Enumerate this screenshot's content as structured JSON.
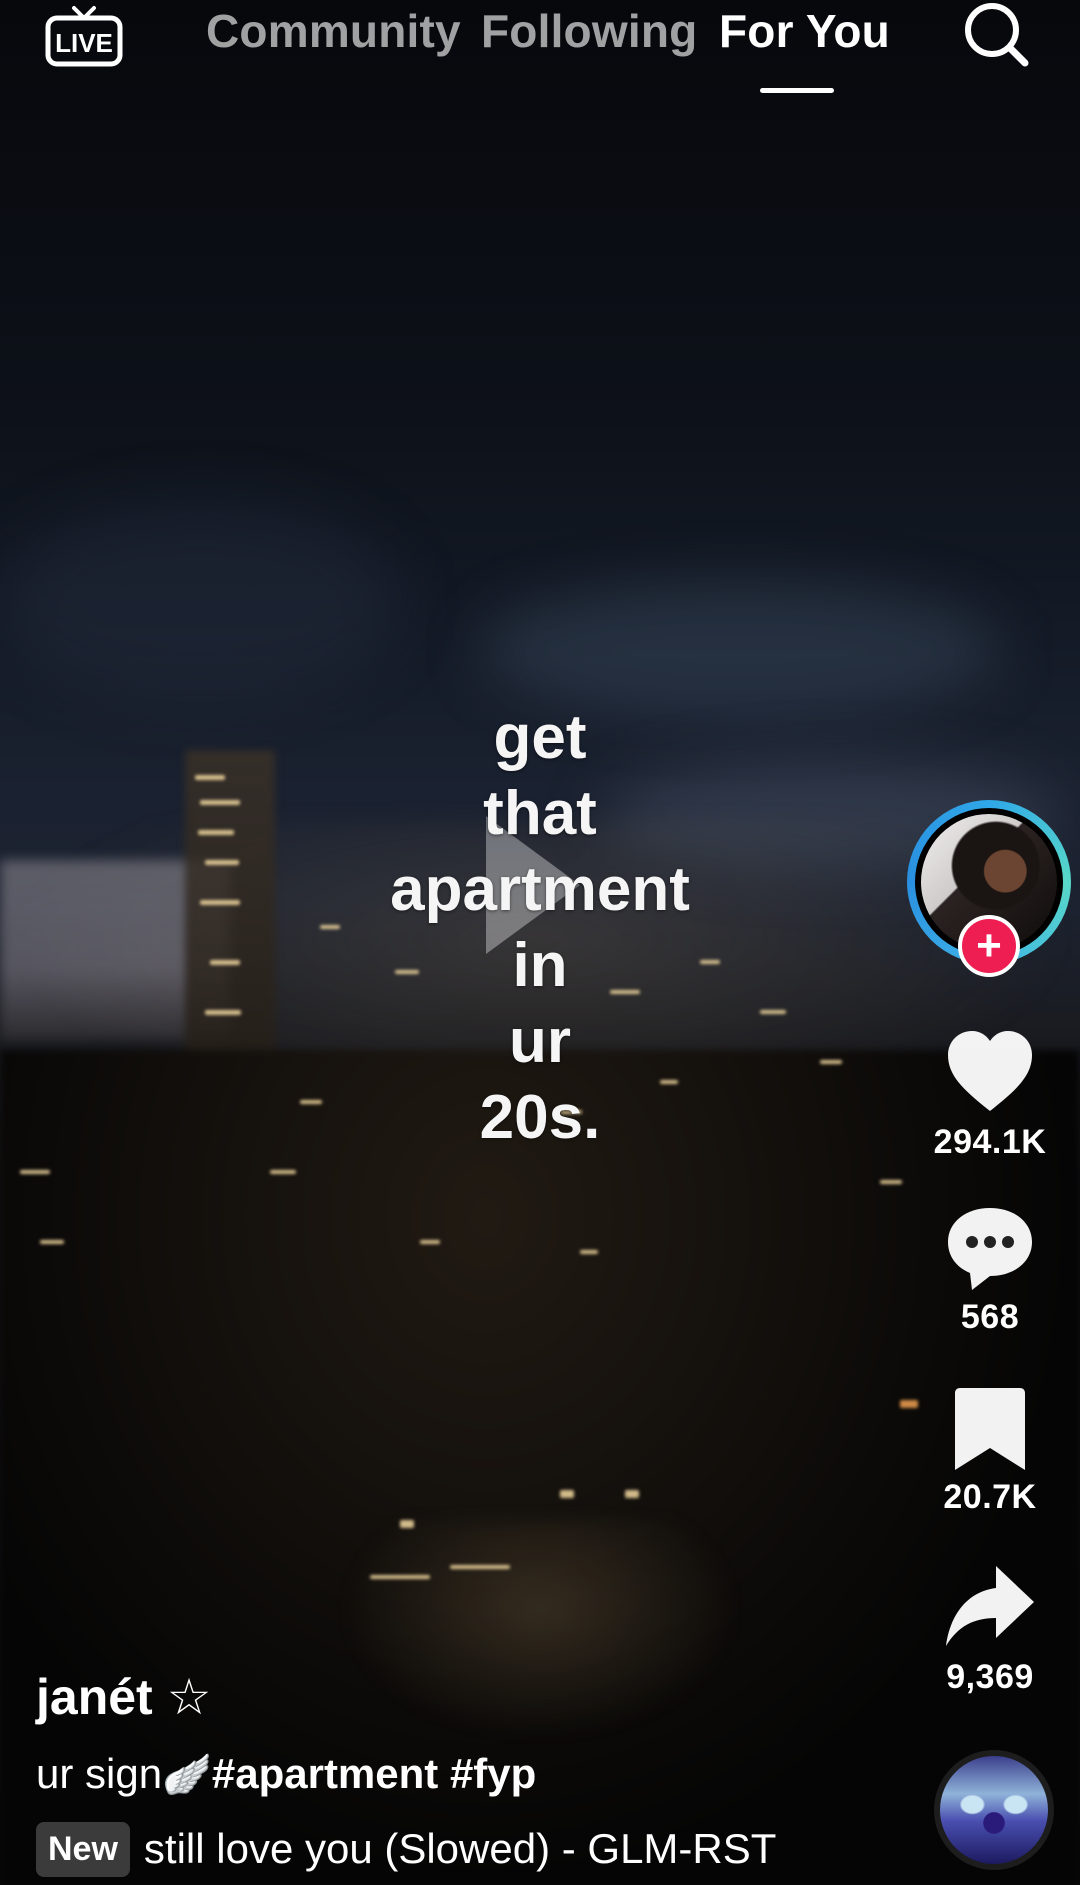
{
  "topnav": {
    "live_label": "LIVE",
    "tabs": [
      {
        "label": "Community"
      },
      {
        "label": "Following"
      },
      {
        "label": "For You"
      }
    ]
  },
  "video": {
    "overlay_lines": [
      "get",
      "that",
      "apartment",
      "in",
      "ur",
      "20s."
    ]
  },
  "creator": {
    "username": "janét ☆",
    "follow_symbol": "+"
  },
  "actions": {
    "likes": "294.1K",
    "comments": "568",
    "saves": "20.7K",
    "shares": "9,369"
  },
  "caption": {
    "text": "ur sign",
    "emoji": "🪽",
    "hashtags": "#apartment #fyp"
  },
  "music": {
    "badge": "New",
    "title": "still love you (Slowed) - GLM-RST"
  },
  "icons": {
    "live": "live-tv-icon",
    "search": "search-icon",
    "like": "heart-icon",
    "comment": "comment-bubble-icon",
    "save": "bookmark-icon",
    "share": "share-arrow-icon",
    "play": "play-icon"
  },
  "colors": {
    "follow_button": "#ee1d52",
    "avatar_ring": "#2fa7e8",
    "active_tab": "#ffffff",
    "inactive_tab": "rgba(255,255,255,0.62)"
  }
}
